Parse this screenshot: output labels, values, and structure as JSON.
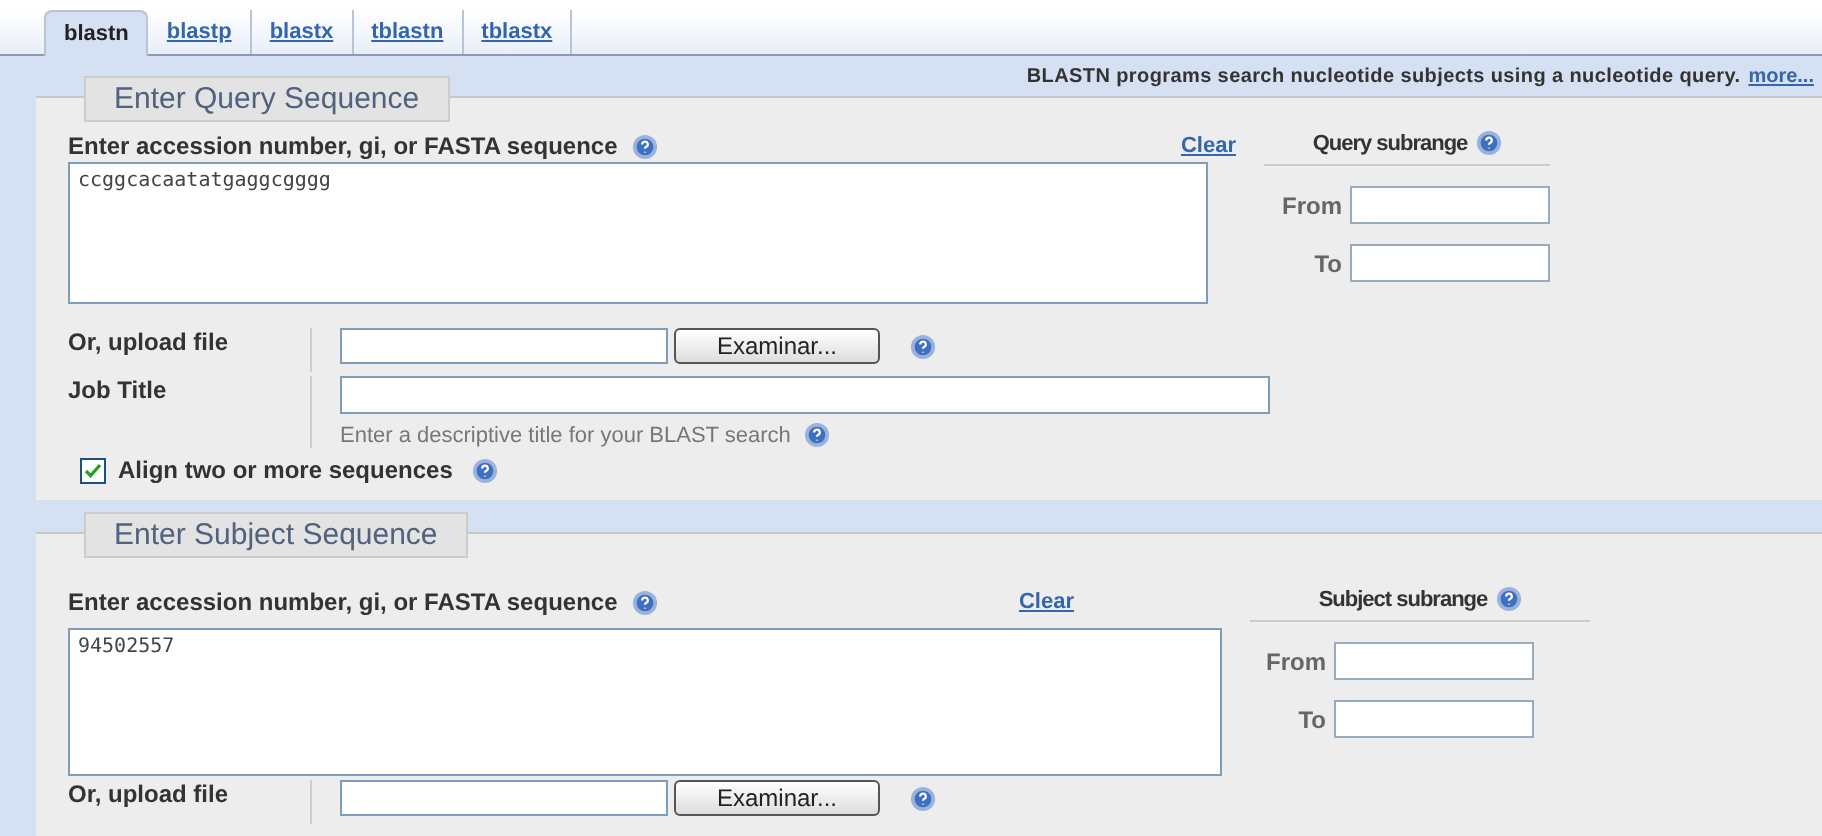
{
  "tabs": [
    {
      "label": "blastn",
      "selected": true
    },
    {
      "label": "blastp",
      "selected": false
    },
    {
      "label": "blastx",
      "selected": false
    },
    {
      "label": "tblastn",
      "selected": false
    },
    {
      "label": "tblastx",
      "selected": false
    }
  ],
  "description": {
    "text": "BLASTN programs search nucleotide subjects using a nucleotide query.",
    "link": "more..."
  },
  "query": {
    "legend": "Enter Query Sequence",
    "sequence_label": "Enter accession number, gi, or FASTA sequence",
    "clear": "Clear",
    "value": "ccggcacaatatgaggcgggg",
    "subrange_title": "Query subrange",
    "from_label": "From",
    "to_label": "To",
    "upload_label": "Or, upload file",
    "browse_button": "Examinar...",
    "job_title_label": "Job Title",
    "job_title_hint": "Enter a descriptive title for your BLAST search",
    "align_label": "Align two or more sequences",
    "align_checked": true
  },
  "subject": {
    "legend": "Enter Subject Sequence",
    "sequence_label": "Enter accession number, gi, or FASTA sequence",
    "clear": "Clear",
    "value": "94502557",
    "subrange_title": "Subject subrange",
    "from_label": "From",
    "to_label": "To",
    "upload_label": "Or, upload file",
    "browse_button": "Examinar..."
  }
}
